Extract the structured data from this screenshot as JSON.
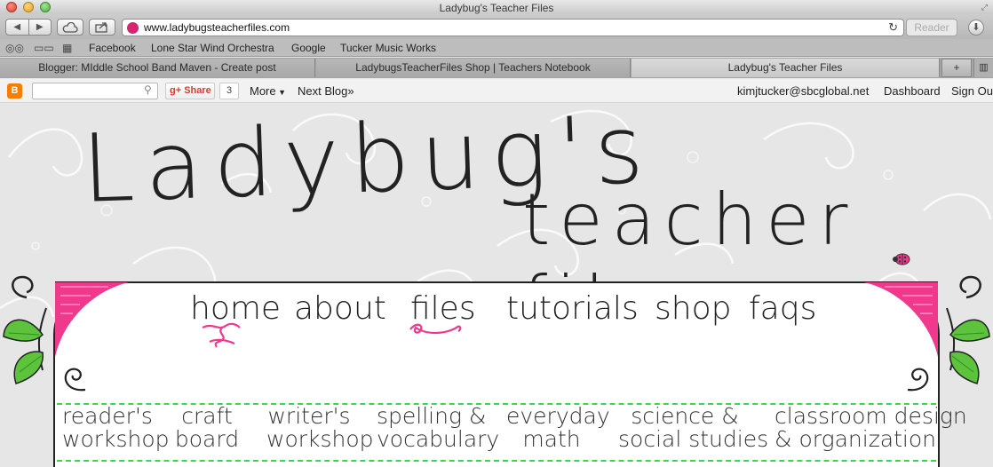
{
  "window": {
    "title": "Ladybug's Teacher Files"
  },
  "toolbar": {
    "url": "www.ladybugsteacherfiles.com",
    "reader_label": "Reader"
  },
  "bookmarks": [
    "Facebook",
    "Lone Star Wind Orchestra",
    "Google",
    "Tucker Music Works"
  ],
  "tabs": [
    {
      "label": "Blogger: MIddle School Band Maven - Create post"
    },
    {
      "label": "LadybugsTeacherFiles Shop | Teachers Notebook"
    },
    {
      "label": "Ladybug's Teacher Files"
    }
  ],
  "blogger_bar": {
    "search_placeholder": "",
    "share_label": "Share",
    "share_count": "3",
    "more_label": "More",
    "next_blog_label": "Next Blog»",
    "user_email": "kimjtucker@sbcglobal.net",
    "dashboard_label": "Dashboard",
    "sign_out_label": "Sign Ou"
  },
  "blog": {
    "title": "Ladybug's",
    "subtitle": "teacher files",
    "nav": [
      "home",
      "about",
      "files",
      "tutorials",
      "shop",
      "faqs"
    ],
    "categories": [
      {
        "line1": "reader's",
        "line2": "workshop"
      },
      {
        "line1": "craft",
        "line2": "board"
      },
      {
        "line1": "writer's",
        "line2": "workshop"
      },
      {
        "line1": "spelling &",
        "line2": "vocabulary"
      },
      {
        "line1": "everyday",
        "line2": "math"
      },
      {
        "line1": "science &",
        "line2": "social studies"
      },
      {
        "line1": "classroom design",
        "line2": "& organization"
      }
    ]
  },
  "colors": {
    "accent_pink": "#f0388c",
    "leaf_green": "#5dc33c",
    "dash_green": "#3fd74a",
    "blogger_orange": "#f57d00"
  }
}
